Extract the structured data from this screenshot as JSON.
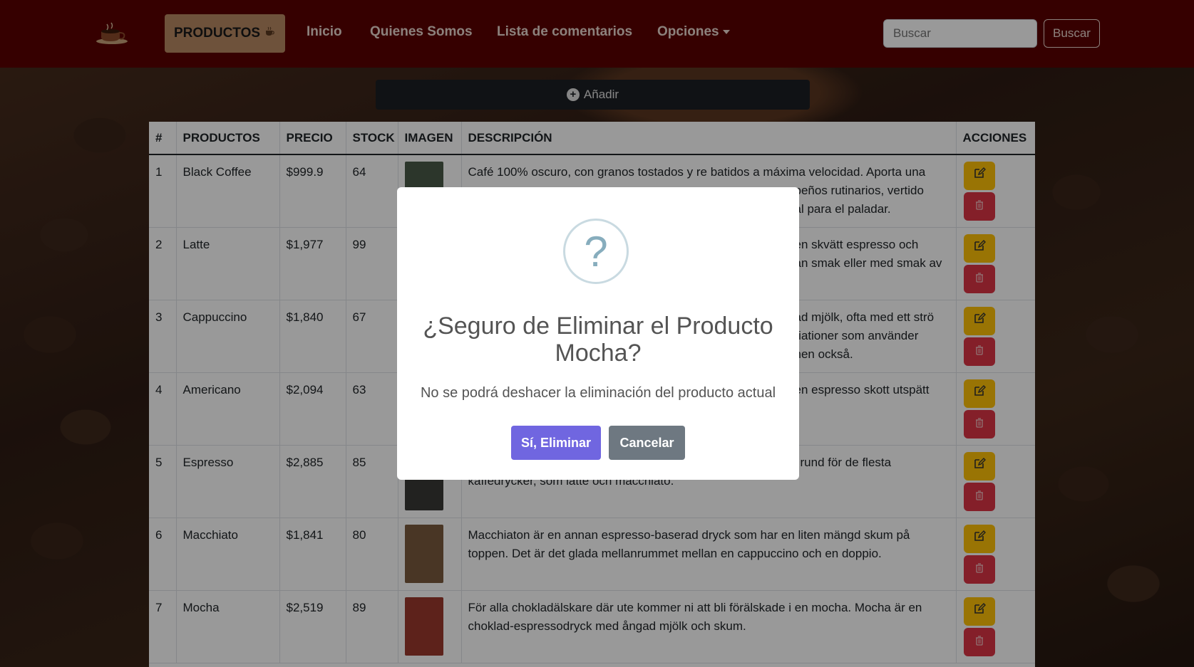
{
  "navbar": {
    "active_label": "PRODUCTOS",
    "links": [
      "Inicio",
      "Quienes Somos",
      "Lista de comentarios",
      "Opciones"
    ],
    "search_placeholder": "Buscar",
    "search_button": "Buscar"
  },
  "add_button": "Añadir",
  "table": {
    "headers": [
      "#",
      "PRODUCTOS",
      "PRECIO",
      "STOCK",
      "IMAGEN",
      "DESCRIPCIÓN",
      "ACCIONES"
    ],
    "rows": [
      {
        "n": "1",
        "name": "Black Coffee",
        "price": "$999.9",
        "stock": "64",
        "desc": "Café 100% oscuro, con granos tostados y re batidos a máxima velocidad. Aporta una",
        "desc2": "peños rutinarios, vertido",
        "desc3": "al para el paladar.",
        "img": "#4a5a48"
      },
      {
        "n": "2",
        "name": "Latte",
        "price": "$1,977",
        "stock": "99",
        "desc": "en skvätt espresso och",
        "desc2": "an smak eller med smak av",
        "desc3": "",
        "img": "#c9b79a"
      },
      {
        "n": "3",
        "name": "Cappuccino",
        "price": "$1,840",
        "stock": "67",
        "desc": "ad mjölk, ofta med ett strö",
        "desc2": "riationer som använder",
        "desc3": "nen också.",
        "img": "#a8937a"
      },
      {
        "n": "4",
        "name": "Americano",
        "price": "$2,094",
        "stock": "63",
        "desc": "en espresso skott utspätt",
        "desc2": "",
        "desc3": "",
        "img": "#6b4a34"
      },
      {
        "n": "5",
        "name": "Espresso",
        "price": "$2,885",
        "stock": "85",
        "desc": "rund för de flesta",
        "desc2": "kaffedrycker, som latte och macchiato.",
        "desc3": "",
        "img": "#3a3a36"
      },
      {
        "n": "6",
        "name": "Macchiato",
        "price": "$1,841",
        "stock": "80",
        "desc": "Macchiaton är en annan espresso-baserad dryck som har en liten mängd skum på",
        "desc2": "toppen. Det är det glada mellanrummet mellan en cappuccino och en doppio.",
        "desc3": "",
        "img": "#7a5a3e"
      },
      {
        "n": "7",
        "name": "Mocha",
        "price": "$2,519",
        "stock": "89",
        "desc": "För alla chokladälskare där ute kommer ni att bli förälskade i en mocha. Mocha är en",
        "desc2": "choklad-espressodryck med ångad mjölk och skum.",
        "desc3": "",
        "img": "#9b3a2e"
      }
    ]
  },
  "modal": {
    "icon": "?",
    "title": "¿Seguro de Eliminar el Producto Mocha?",
    "text": "No se podrá deshacer la eliminación del producto actual",
    "confirm": "Sí, Eliminar",
    "cancel": "Cancelar"
  }
}
